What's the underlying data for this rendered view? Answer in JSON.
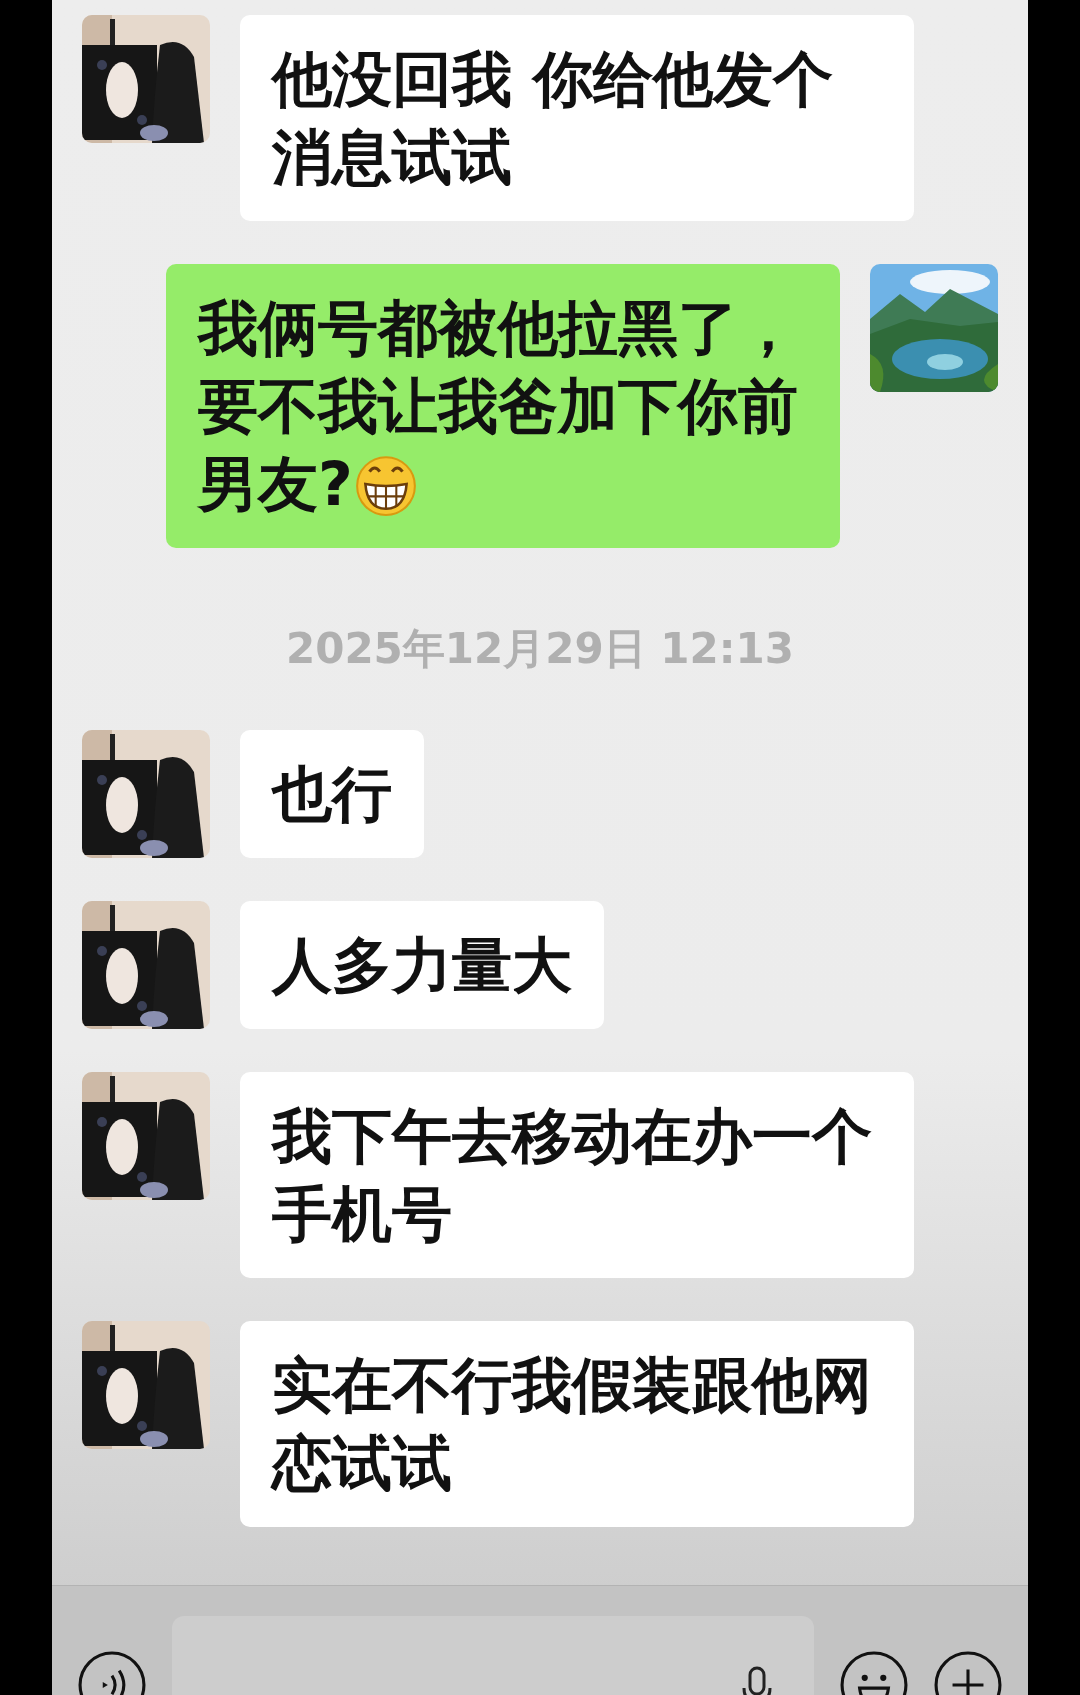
{
  "messages": [
    {
      "kind": "message",
      "outgoing": false,
      "text": "他没回我 你给他发个消息试试",
      "emoji": false
    },
    {
      "kind": "message",
      "outgoing": true,
      "text": "我俩号都被他拉黑了，要不我让我爸加下你前男友?",
      "emoji": true
    },
    {
      "kind": "timestamp",
      "text": "2025年12月29日 12:13"
    },
    {
      "kind": "message",
      "outgoing": false,
      "text": "也行",
      "emoji": false
    },
    {
      "kind": "message",
      "outgoing": false,
      "text": "人多力量大",
      "emoji": false
    },
    {
      "kind": "message",
      "outgoing": false,
      "text": "我下午去移动在办一个手机号",
      "emoji": false
    },
    {
      "kind": "message",
      "outgoing": false,
      "text": "实在不行我假装跟他网恋试试",
      "emoji": false
    }
  ]
}
